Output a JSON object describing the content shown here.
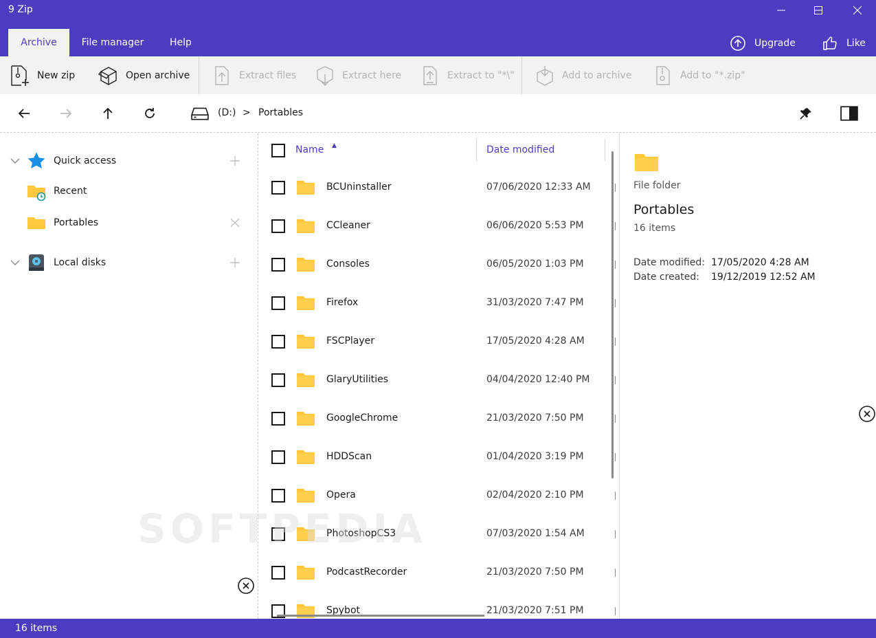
{
  "app": {
    "title": "9 Zip"
  },
  "tabs": [
    {
      "label": "Archive",
      "active": true
    },
    {
      "label": "File manager",
      "active": false
    },
    {
      "label": "Help",
      "active": false
    }
  ],
  "top_actions": {
    "upgrade": "Upgrade",
    "like": "Like"
  },
  "ribbon": {
    "new_zip": "New zip",
    "open_archive": "Open archive",
    "extract_files": "Extract files",
    "extract_here": "Extract here",
    "extract_to": "Extract to \"*\\\"",
    "add_to_archive": "Add to archive",
    "add_to_zip": "Add to \"*.zip\""
  },
  "nav": {
    "drive": "(D:)",
    "separator": ">",
    "folder": "Portables"
  },
  "sidebar": {
    "quick_access": "Quick access",
    "recent": "Recent",
    "portables": "Portables",
    "local_disks": "Local disks"
  },
  "list": {
    "columns": {
      "name": "Name",
      "date": "Date modified",
      "sort_arrow": "▲"
    },
    "rows": [
      {
        "name": "BCUninstaller",
        "date": "07/06/2020 12:33 AM"
      },
      {
        "name": "CCleaner",
        "date": "06/06/2020 5:53 PM"
      },
      {
        "name": "Consoles",
        "date": "06/05/2020 1:03 PM"
      },
      {
        "name": "Firefox",
        "date": "31/03/2020 7:47 PM"
      },
      {
        "name": "FSCPlayer",
        "date": "17/05/2020 4:28 AM"
      },
      {
        "name": "GlaryUtilities",
        "date": "04/04/2020 12:40 PM"
      },
      {
        "name": "GoogleChrome",
        "date": "21/03/2020 7:50 PM"
      },
      {
        "name": "HDDScan",
        "date": "01/04/2020 3:19 PM"
      },
      {
        "name": "Opera",
        "date": "02/04/2020 2:10 PM"
      },
      {
        "name": "PhotoshopCS3",
        "date": "07/03/2020 1:54 AM"
      },
      {
        "name": "PodcastRecorder",
        "date": "21/03/2020 7:50 PM"
      },
      {
        "name": "Spybot",
        "date": "21/03/2020 7:51 PM"
      }
    ]
  },
  "details": {
    "type": "File folder",
    "name": "Portables",
    "count": "16 items",
    "date_modified_label": "Date modified:",
    "date_modified": "17/05/2020 4:28 AM",
    "date_created_label": "Date created:",
    "date_created": "19/12/2019 12:52 AM"
  },
  "status": {
    "items": "16 items"
  },
  "watermark": "SOFTPEDIA",
  "colors": {
    "accent": "#4c3cc0",
    "folder": "#ffc83d",
    "ribbon_bg": "#f2f2f2"
  }
}
